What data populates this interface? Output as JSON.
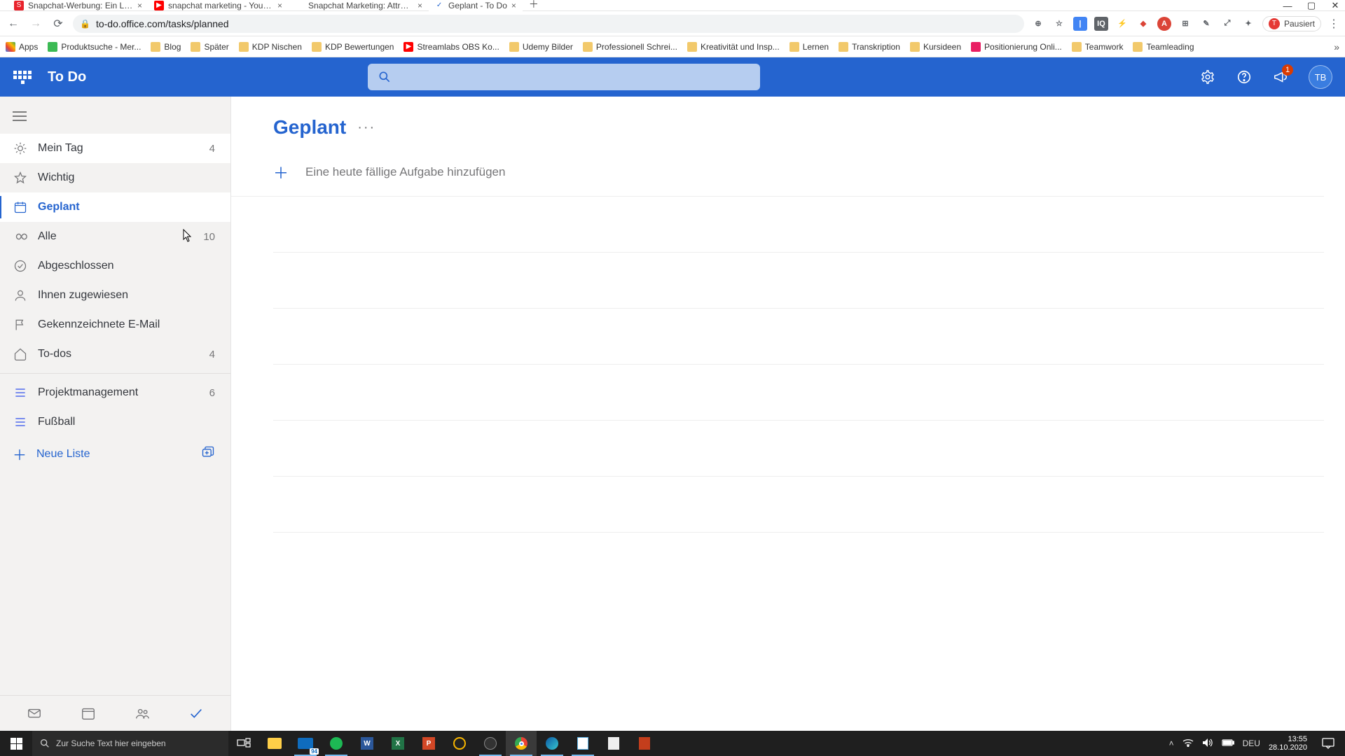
{
  "browser": {
    "tabs": [
      {
        "title": "Snapchat-Werbung: Ein Leitfade",
        "favicon_bg": "#e8232c",
        "favicon_text": "S",
        "favicon_color": "#fff"
      },
      {
        "title": "snapchat marketing - YouTube",
        "favicon_bg": "#ff0000",
        "favicon_text": "▶",
        "favicon_color": "#fff"
      },
      {
        "title": "Snapchat Marketing: Attract New",
        "favicon_bg": "#ffffff",
        "favicon_text": "",
        "favicon_color": "#000"
      },
      {
        "title": "Geplant - To Do",
        "favicon_bg": "#ffffff",
        "favicon_text": "✓",
        "favicon_color": "#2564cf",
        "active": true
      }
    ],
    "url": "to-do.office.com/tasks/planned",
    "bookmarks": [
      {
        "label": "Apps",
        "kind": "apps"
      },
      {
        "label": "Produktsuche - Mer...",
        "kind": "site",
        "bg": "#3cba54"
      },
      {
        "label": "Blog",
        "kind": "folder"
      },
      {
        "label": "Später",
        "kind": "folder"
      },
      {
        "label": "KDP Nischen",
        "kind": "folder"
      },
      {
        "label": "KDP Bewertungen",
        "kind": "folder"
      },
      {
        "label": "Streamlabs OBS Ko...",
        "kind": "site",
        "bg": "#ff0000"
      },
      {
        "label": "Udemy Bilder",
        "kind": "folder"
      },
      {
        "label": "Professionell Schrei...",
        "kind": "folder"
      },
      {
        "label": "Kreativität und Insp...",
        "kind": "folder"
      },
      {
        "label": "Lernen",
        "kind": "folder"
      },
      {
        "label": "Transkription",
        "kind": "folder"
      },
      {
        "label": "Kursideen",
        "kind": "folder"
      },
      {
        "label": "Positionierung Onli...",
        "kind": "site",
        "bg": "#e91e63"
      },
      {
        "label": "Teamwork",
        "kind": "folder"
      },
      {
        "label": "Teamleading",
        "kind": "folder"
      }
    ],
    "profile": {
      "initial": "T",
      "label": "Pausiert"
    }
  },
  "app": {
    "brand": "To Do",
    "search_placeholder": "",
    "notifications_count": "1",
    "avatar_initials": "TB",
    "sidebar": {
      "items": [
        {
          "name": "my-day",
          "label": "Mein Tag",
          "count": "4",
          "hovered": true
        },
        {
          "name": "important",
          "label": "Wichtig",
          "count": ""
        },
        {
          "name": "planned",
          "label": "Geplant",
          "count": "",
          "active": true
        },
        {
          "name": "all",
          "label": "Alle",
          "count": "10"
        },
        {
          "name": "completed",
          "label": "Abgeschlossen",
          "count": ""
        },
        {
          "name": "assigned",
          "label": "Ihnen zugewiesen",
          "count": ""
        },
        {
          "name": "flagged",
          "label": "Gekennzeichnete E-Mail",
          "count": ""
        },
        {
          "name": "todos",
          "label": "To-dos",
          "count": "4"
        }
      ],
      "custom_lists": [
        {
          "label": "Projektmanagement",
          "count": "6"
        },
        {
          "label": "Fußball",
          "count": ""
        }
      ],
      "new_list_label": "Neue Liste"
    },
    "main": {
      "title": "Geplant",
      "add_task_placeholder": "Eine heute fällige Aufgabe hinzufügen"
    }
  },
  "taskbar": {
    "search_placeholder": "Zur Suche Text hier eingeben",
    "lang": "DEU",
    "time": "13:55",
    "date": "28.10.2020",
    "mail_badge": "94"
  }
}
